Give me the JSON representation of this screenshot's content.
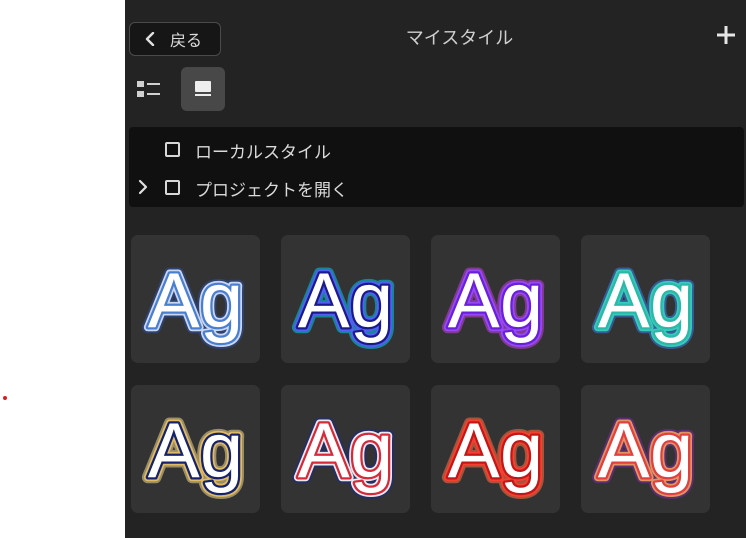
{
  "header": {
    "back_label": "戻る",
    "title": "マイスタイル",
    "back_icon": "chevron-left-icon",
    "add_icon": "plus-icon"
  },
  "view_toggle": {
    "list_icon": "list-view-icon",
    "grid_icon": "grid-view-icon",
    "active": "grid"
  },
  "folders": [
    {
      "label": "ローカルスタイル",
      "checked": false,
      "expandable": false
    },
    {
      "label": "プロジェクトを開く",
      "checked": false,
      "expandable": true
    }
  ],
  "styles": [
    {
      "text": "Ag",
      "fill": "#ffffff",
      "inner": "#4a7fd0",
      "glow": "#dde8ff",
      "outer": "#2b4f9e"
    },
    {
      "text": "Ag",
      "fill": "#ffffff",
      "inner": "#1a1a8a",
      "glow": "#5a5cff",
      "outer": "#00c8e8"
    },
    {
      "text": "Ag",
      "fill": "#ffffff",
      "inner": "#6a1fd8",
      "glow": "#9a4cff",
      "outer": "#c23fe0"
    },
    {
      "text": "Ag",
      "fill": "#ffffff",
      "inner": "#2ab8a8",
      "glow": "#3ad6c0",
      "outer": "#3a7fe8"
    },
    {
      "text": "Ag",
      "fill": "#ffffff",
      "inner": "#16226a",
      "glow": "#e8c060",
      "outer": "#f0d890"
    },
    {
      "text": "Ag",
      "fill": "#ffffff",
      "inner": "#d42a3a",
      "glow": "#ffffff",
      "outer": "#1a2a8a"
    },
    {
      "text": "Ag",
      "fill": "#ffffff",
      "inner": "#c01818",
      "glow": "#ff4030",
      "outer": "#ff7040"
    },
    {
      "text": "Ag",
      "fill": "#ffffff",
      "inner": "#e04040",
      "glow": "#f0a060",
      "outer": "#7a2aa0"
    }
  ]
}
